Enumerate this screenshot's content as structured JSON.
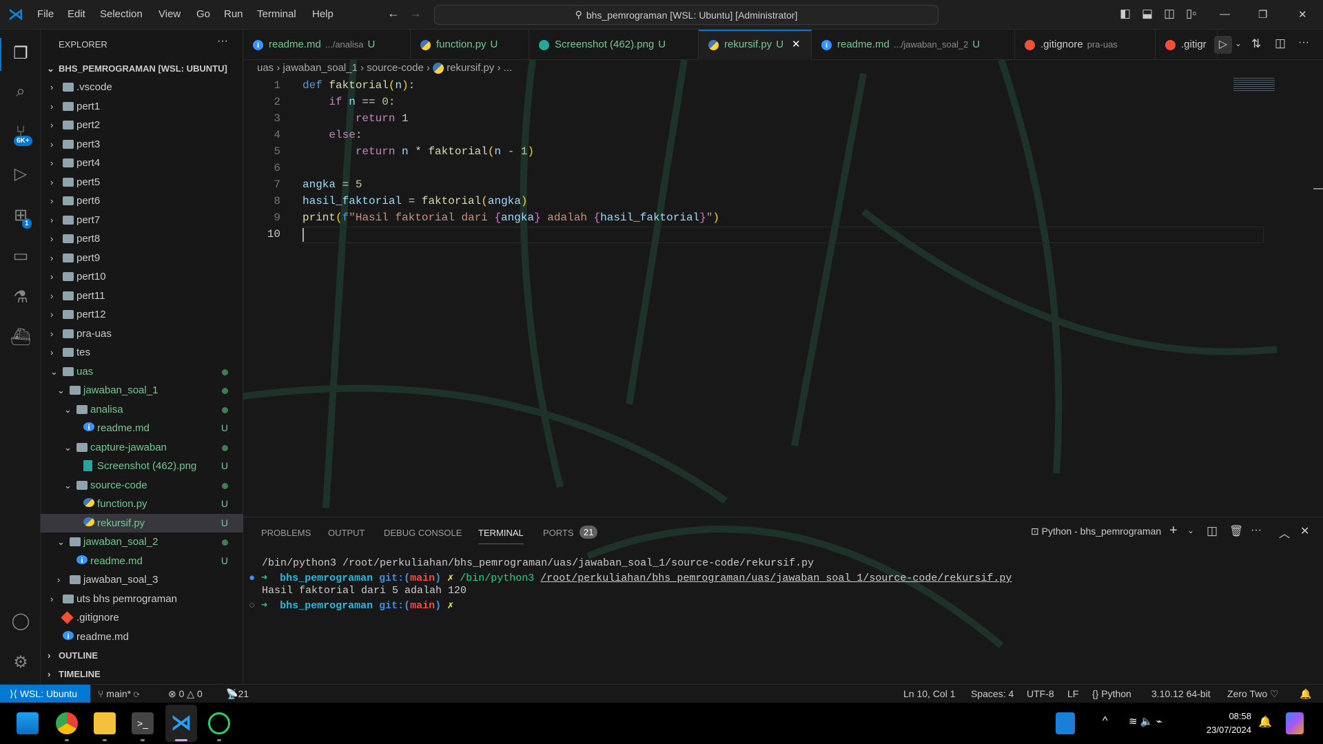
{
  "menu": [
    "File",
    "Edit",
    "Selection",
    "View",
    "Go",
    "Run",
    "Terminal",
    "Help"
  ],
  "search": "bhs_pemrograman [WSL: Ubuntu] [Administrator]",
  "activity": {
    "scm_badge": "6K+",
    "ext_badge": "1"
  },
  "explorer": {
    "title": "EXPLORER",
    "root": "BHS_PEMROGRAMAN [WSL: UBUNTU]",
    "outline": "OUTLINE",
    "timeline": "TIMELINE",
    "items": [
      {
        "label": ".vscode",
        "depth": 0,
        "type": "folder",
        "open": false
      },
      {
        "label": "pert1",
        "depth": 0,
        "type": "folder",
        "open": false
      },
      {
        "label": "pert2",
        "depth": 0,
        "type": "folder",
        "open": false
      },
      {
        "label": "pert3",
        "depth": 0,
        "type": "folder",
        "open": false
      },
      {
        "label": "pert4",
        "depth": 0,
        "type": "folder",
        "open": false
      },
      {
        "label": "pert5",
        "depth": 0,
        "type": "folder",
        "open": false
      },
      {
        "label": "pert6",
        "depth": 0,
        "type": "folder",
        "open": false
      },
      {
        "label": "pert7",
        "depth": 0,
        "type": "folder",
        "open": false
      },
      {
        "label": "pert8",
        "depth": 0,
        "type": "folder",
        "open": false
      },
      {
        "label": "pert9",
        "depth": 0,
        "type": "folder",
        "open": false
      },
      {
        "label": "pert10",
        "depth": 0,
        "type": "folder",
        "open": false
      },
      {
        "label": "pert11",
        "depth": 0,
        "type": "folder",
        "open": false
      },
      {
        "label": "pert12",
        "depth": 0,
        "type": "folder",
        "open": false
      },
      {
        "label": "pra-uas",
        "depth": 0,
        "type": "folder",
        "open": false
      },
      {
        "label": "tes",
        "depth": 0,
        "type": "folder",
        "open": false
      },
      {
        "label": "uas",
        "depth": 0,
        "type": "folder",
        "open": true,
        "status": "dot"
      },
      {
        "label": "jawaban_soal_1",
        "depth": 1,
        "type": "folder",
        "open": true,
        "status": "dot"
      },
      {
        "label": "analisa",
        "depth": 2,
        "type": "folder",
        "open": true,
        "status": "dot"
      },
      {
        "label": "readme.md",
        "depth": 3,
        "type": "md",
        "status": "U"
      },
      {
        "label": "capture-jawaban",
        "depth": 2,
        "type": "folder",
        "open": true,
        "status": "dot"
      },
      {
        "label": "Screenshot (462).png",
        "depth": 3,
        "type": "img",
        "status": "U"
      },
      {
        "label": "source-code",
        "depth": 2,
        "type": "folder",
        "open": true,
        "status": "dot"
      },
      {
        "label": "function.py",
        "depth": 3,
        "type": "py",
        "status": "U"
      },
      {
        "label": "rekursif.py",
        "depth": 3,
        "type": "py",
        "status": "U",
        "selected": true
      },
      {
        "label": "jawaban_soal_2",
        "depth": 1,
        "type": "folder",
        "open": true,
        "status": "dot"
      },
      {
        "label": "readme.md",
        "depth": 2,
        "type": "md",
        "status": "U"
      },
      {
        "label": "jawaban_soal_3",
        "depth": 1,
        "type": "folder",
        "open": false
      },
      {
        "label": "uts bhs pemrograman",
        "depth": 0,
        "type": "folder",
        "open": false
      },
      {
        "label": ".gitignore",
        "depth": 0,
        "type": "git"
      },
      {
        "label": "readme.md",
        "depth": 0,
        "type": "md"
      }
    ]
  },
  "tabs": [
    {
      "label": "readme.md",
      "desc": ".../analisa",
      "status": "U",
      "type": "md"
    },
    {
      "label": "function.py",
      "desc": "",
      "status": "U",
      "type": "py"
    },
    {
      "label": "Screenshot (462).png",
      "desc": "",
      "status": "U",
      "type": "img"
    },
    {
      "label": "rekursif.py",
      "desc": "",
      "status": "U",
      "type": "py",
      "active": true
    },
    {
      "label": "readme.md",
      "desc": ".../jawaban_soal_2",
      "status": "U",
      "type": "md"
    },
    {
      "label": ".gitignore",
      "desc": "pra-uas",
      "status": "",
      "type": "git"
    },
    {
      "label": ".gitigr",
      "desc": "",
      "status": "",
      "type": "git"
    }
  ],
  "breadcrumb": [
    "uas",
    "jawaban_soal_1",
    "source-code",
    "rekursif.py",
    "..."
  ],
  "code": [
    "def faktorial(n):",
    "    if n == 0:",
    "        return 1",
    "    else:",
    "        return n * faktorial(n - 1)",
    "",
    "angka = 5",
    "hasil_faktorial = faktorial(angka)",
    "print(f\"Hasil faktorial dari {angka} adalah {hasil_faktorial}\")",
    ""
  ],
  "panel": {
    "tabs": [
      "PROBLEMS",
      "OUTPUT",
      "DEBUG CONSOLE",
      "TERMINAL",
      "PORTS"
    ],
    "ports_count": "21",
    "terminal_name": "Python - bhs_pemrograman",
    "lines": {
      "cmd0": "/bin/python3 /root/perkuliahan/bhs_pemrograman/uas/jawaban_soal_1/source-code/rekursif.py",
      "dir": "bhs_pemrograman",
      "git": "git:(",
      "branch": "main",
      "close": ")",
      "x": "✗",
      "py": "/bin/python3",
      "path": "/root/perkuliahan/bhs_pemrograman/uas/jawaban_soal_1/source-code/rekursif.py",
      "out": "Hasil faktorial dari 5 adalah 120"
    }
  },
  "status": {
    "remote": "WSL: Ubuntu",
    "branch": "main*",
    "errors": "0",
    "warnings": "0",
    "ports": "21",
    "position": "Ln 10, Col 1",
    "spaces": "Spaces: 4",
    "encoding": "UTF-8",
    "eol": "LF",
    "language": "Python",
    "interpreter": "3.10.12 64-bit",
    "profile": "Zero Two"
  },
  "taskbar": {
    "time": "08:58",
    "date": "23/07/2024"
  }
}
